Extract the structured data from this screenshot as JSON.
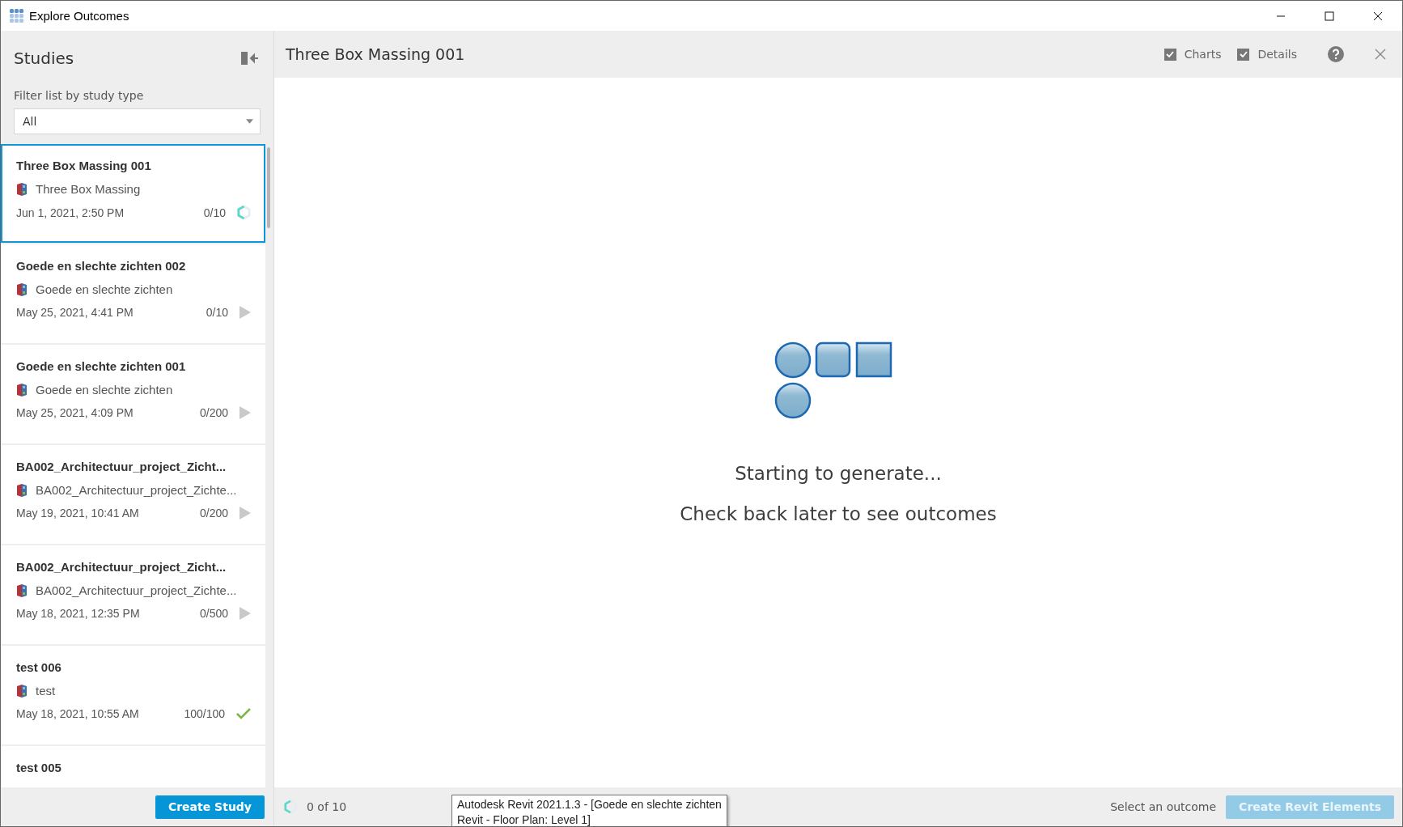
{
  "window": {
    "title": "Explore Outcomes"
  },
  "sidebar": {
    "title": "Studies",
    "filter_label": "Filter list by study type",
    "filter_value": "All",
    "studies": [
      {
        "title": "Three Box Massing 001",
        "source": "Three Box Massing",
        "date": "Jun 1, 2021, 2:50 PM",
        "count": "0/10",
        "kind": "running",
        "selected": true
      },
      {
        "title": "Goede en slechte zichten 002",
        "source": "Goede en slechte zichten",
        "date": "May 25, 2021, 4:41 PM",
        "count": "0/10",
        "kind": "play",
        "selected": false
      },
      {
        "title": "Goede en slechte zichten 001",
        "source": "Goede en slechte zichten",
        "date": "May 25, 2021, 4:09 PM",
        "count": "0/200",
        "kind": "play",
        "selected": false
      },
      {
        "title": "BA002_Architectuur_project_Zicht...",
        "source": "BA002_Architectuur_project_Zichte...",
        "date": "May 19, 2021, 10:41 AM",
        "count": "0/200",
        "kind": "play",
        "selected": false
      },
      {
        "title": "BA002_Architectuur_project_Zicht...",
        "source": "BA002_Architectuur_project_Zichte...",
        "date": "May 18, 2021, 12:35 PM",
        "count": "0/500",
        "kind": "play",
        "selected": false
      },
      {
        "title": "test 006",
        "source": "test",
        "date": "May 18, 2021, 10:55 AM",
        "count": "100/100",
        "kind": "done",
        "selected": false
      },
      {
        "title": "test 005",
        "kind": "partial",
        "selected": false
      }
    ],
    "create_button": "Create Study"
  },
  "main": {
    "title": "Three Box Massing 001",
    "toggles": [
      {
        "label": "Charts",
        "checked": true
      },
      {
        "label": "Details",
        "checked": true
      }
    ],
    "status_line": "Starting to generate...",
    "hint": "Check back later to see outcomes"
  },
  "status_bar": {
    "progress": "0 of 10",
    "selection": "Select an outcome",
    "action_button": "Create Revit Elements",
    "action_disabled": true
  },
  "tooltip": {
    "lines": [
      "Autodesk Revit 2021.1.3 - [Goede en slechte zichten",
      "Revit - Floor Plan: Level 1]"
    ]
  }
}
